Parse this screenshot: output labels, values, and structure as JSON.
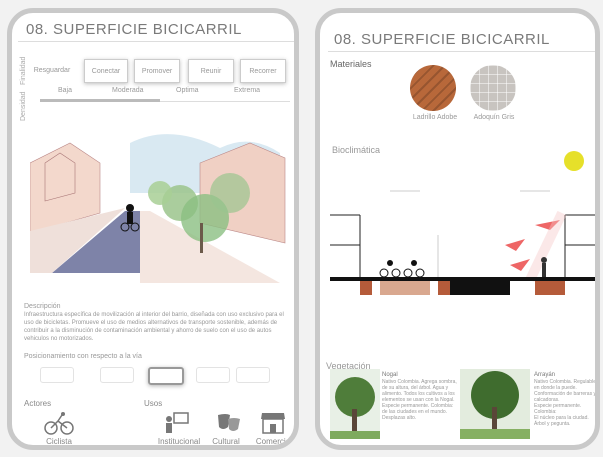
{
  "left": {
    "title": "08. SUPERFICIE BICICARRIL",
    "tabs": [
      "Resguardar",
      "Conectar",
      "Promover",
      "Reunir",
      "Recorrer"
    ],
    "vertical_labels": [
      "Finalidad",
      "Densidad"
    ],
    "density_levels": [
      "Baja",
      "Moderada",
      "Optima",
      "Extrema"
    ],
    "description_heading": "Descripción",
    "description_text": "Infraestructura específica de movilización al interior del barrio, diseñada con uso exclusivo para el uso de bicicletas. Promueve el uso de medios alternativos de transporte sostenible, además de contribuir a la disminución de contaminación ambiental y ahorro de suelo con el uso de autos vehiculos no motorizados.",
    "position_label": "Posicionamiento con respecto a la vía",
    "actors_heading": "Actores",
    "actors": [
      {
        "label": "Ciclista",
        "icon": "cyclist-icon"
      }
    ],
    "uses_heading": "Usos",
    "uses": [
      {
        "label": "Institucional",
        "icon": "teacher-icon"
      },
      {
        "label": "Cultural",
        "icon": "theater-masks-icon"
      },
      {
        "label": "Comercio",
        "icon": "store-icon"
      }
    ]
  },
  "right": {
    "title": "08. SUPERFICIE BICICARRIL",
    "materials_heading": "Materiales",
    "materials": [
      {
        "label": "Ladrillo Adobe",
        "color": "#b8683a"
      },
      {
        "label": "Adoquín Gris",
        "color": "#c8c4c0"
      }
    ],
    "bioclimatic_heading": "Bioclimática",
    "vegetation_heading": "Vegetación",
    "trees": [
      {
        "name": "Nogal",
        "text": "Nativo Colombia. Agrega sombra, de su altura, del árbol. Agua y alimento. Todos los cultivos a los elementos se usan con la Nogal.\nEspecie permanente. Colombia:\nde las ciudades en el mundo. Desplazas alto."
      },
      {
        "name": "Arrayán",
        "text": "Nativo Colombia. Regulable en donde la puede. Conformación de barreras y calcadoras.\nEspecie permanente. Colombia:\nEl núcleo para la ciudad. Árbol y pegunta."
      }
    ]
  }
}
